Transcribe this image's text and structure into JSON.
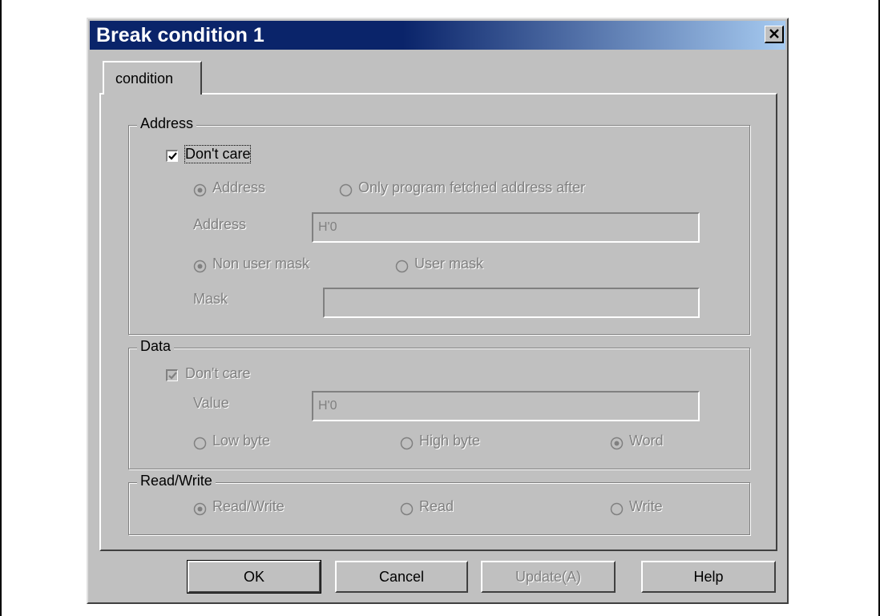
{
  "window": {
    "title": "Break condition 1",
    "close_glyph": "×"
  },
  "tabs": [
    {
      "label": "condition",
      "active": true
    }
  ],
  "address_group": {
    "legend": "Address",
    "dont_care": {
      "label": "Don't care",
      "checked": true,
      "enabled": true
    },
    "radio_address": {
      "label": "Address",
      "selected": true,
      "enabled": false
    },
    "radio_fetched": {
      "label": "Only program fetched address after",
      "selected": false,
      "enabled": false
    },
    "address_field": {
      "label": "Address",
      "value": "H'0"
    },
    "radio_non_user_mask": {
      "label": "Non user mask",
      "selected": true,
      "enabled": false
    },
    "radio_user_mask": {
      "label": "User mask",
      "selected": false,
      "enabled": false
    },
    "mask_field": {
      "label": "Mask",
      "value": ""
    }
  },
  "data_group": {
    "legend": "Data",
    "dont_care": {
      "label": "Don't care",
      "checked": true,
      "enabled": false
    },
    "value_field": {
      "label": "Value",
      "value": "H'0"
    },
    "radio_low_byte": {
      "label": "Low byte",
      "selected": false
    },
    "radio_high_byte": {
      "label": "High byte",
      "selected": false
    },
    "radio_word": {
      "label": "Word",
      "selected": true
    }
  },
  "rw_group": {
    "legend": "Read/Write",
    "radio_read_write": {
      "label": "Read/Write",
      "selected": true
    },
    "radio_read": {
      "label": "Read",
      "selected": false
    },
    "radio_write": {
      "label": "Write",
      "selected": false
    }
  },
  "buttons": {
    "ok": "OK",
    "cancel": "Cancel",
    "update": "Update(A)",
    "help": "Help"
  },
  "colors": {
    "title_bar": "#0a246a",
    "face": "#c0c0c0",
    "disabled_text": "#808080"
  }
}
